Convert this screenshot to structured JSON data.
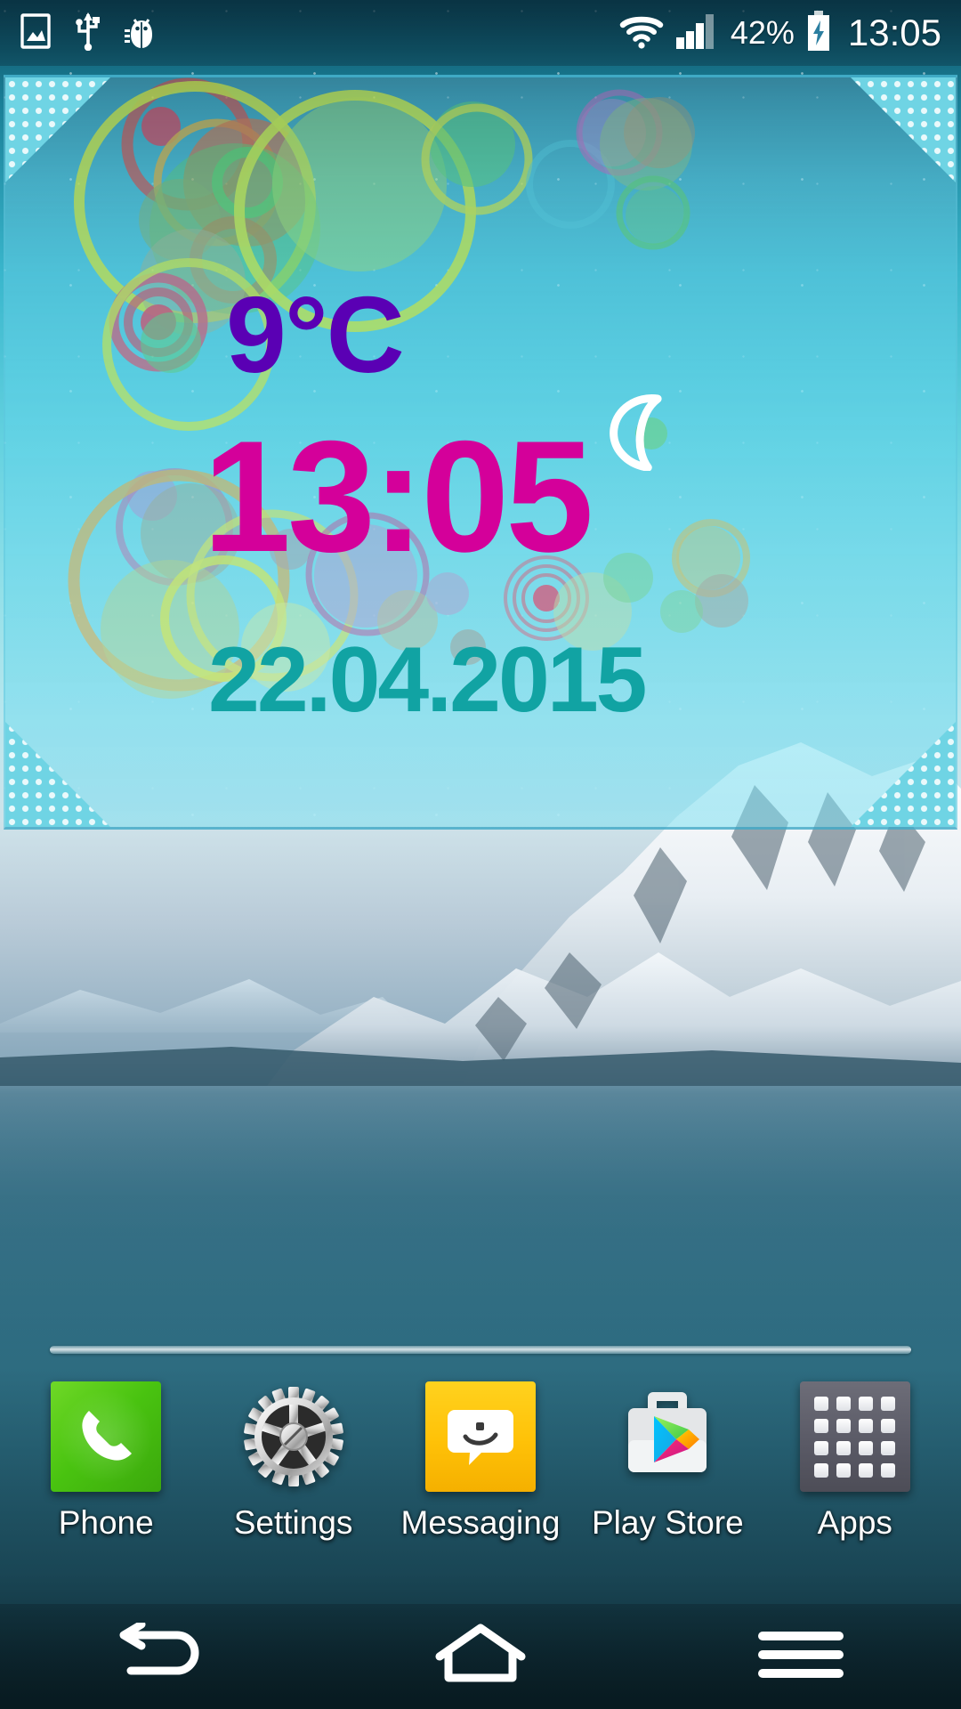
{
  "statusbar": {
    "icons_left": [
      {
        "name": "screenshot-icon",
        "label": "screenshot"
      },
      {
        "name": "usb-icon",
        "label": "usb"
      },
      {
        "name": "usb-debug-icon",
        "label": "usb-debugging"
      }
    ],
    "icons_right": [
      {
        "name": "wifi-icon",
        "label": "wifi"
      },
      {
        "name": "signal-icon",
        "label": "cellular-signal"
      },
      {
        "name": "battery-charging-icon",
        "label": "battery-charging"
      }
    ],
    "battery": "42%",
    "clock": "13:05"
  },
  "widget": {
    "temperature": "9°C",
    "weather_icon": "crescent-moon-icon",
    "time": "13:05",
    "date": "22.04.2015",
    "colors": {
      "temperature": "#5a00b4",
      "time": "#d4009a",
      "date": "#11a3a3",
      "frame": "#6fd4e4"
    }
  },
  "dock": {
    "items": [
      {
        "label": "Phone",
        "icon": "phone-icon"
      },
      {
        "label": "Settings",
        "icon": "gear-icon"
      },
      {
        "label": "Messaging",
        "icon": "message-bubble-icon"
      },
      {
        "label": "Play Store",
        "icon": "play-store-icon"
      },
      {
        "label": "Apps",
        "icon": "apps-grid-icon"
      }
    ]
  },
  "navbar": {
    "buttons": [
      {
        "name": "back-button",
        "icon": "back-arrow-icon"
      },
      {
        "name": "home-button",
        "icon": "home-icon"
      },
      {
        "name": "menu-button",
        "icon": "hamburger-menu-icon"
      }
    ]
  }
}
